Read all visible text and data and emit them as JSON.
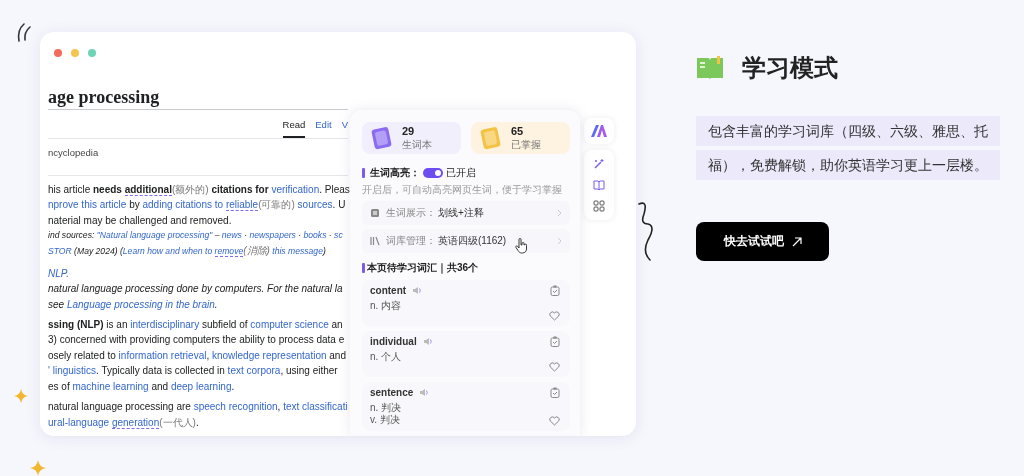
{
  "article": {
    "title": "age processing",
    "tabs": [
      {
        "label": "Read",
        "selected": true
      },
      {
        "label": "Edit",
        "selected": false
      },
      {
        "label": "V",
        "selected": false
      }
    ],
    "subtitle": "ncyclopedia",
    "notice": [
      {
        "italic": false,
        "segments": [
          {
            "text": "his article ",
            "kind": "plain"
          },
          {
            "text": "needs ",
            "kind": "bold"
          },
          {
            "text": "additional",
            "kind": "bold_word"
          },
          {
            "text": "(额外的)",
            "kind": "gloss"
          },
          {
            "text": " citations for ",
            "kind": "bold"
          },
          {
            "text": "verification",
            "kind": "link"
          },
          {
            "text": ". Pleas",
            "kind": "plain"
          }
        ]
      },
      {
        "italic": false,
        "segments": [
          {
            "text": "nprove this article",
            "kind": "link"
          },
          {
            "text": " by ",
            "kind": "plain"
          },
          {
            "text": "adding citations to ",
            "kind": "link"
          },
          {
            "text": "reliable",
            "kind": "link_word"
          },
          {
            "text": "(可靠的)",
            "kind": "gloss"
          },
          {
            "text": " sources",
            "kind": "link"
          },
          {
            "text": ". U",
            "kind": "plain"
          }
        ]
      },
      {
        "italic": false,
        "segments": [
          {
            "text": "naterial may be challenged and removed.",
            "kind": "plain"
          }
        ]
      },
      {
        "italic": true,
        "segments": [
          {
            "text": "ind sources: ",
            "kind": "plain"
          },
          {
            "text": "\"Natural language processing\"",
            "kind": "link"
          },
          {
            "text": " – ",
            "kind": "plain"
          },
          {
            "text": "news",
            "kind": "link"
          },
          {
            "text": " · ",
            "kind": "plain"
          },
          {
            "text": "newspapers",
            "kind": "link"
          },
          {
            "text": " · ",
            "kind": "plain"
          },
          {
            "text": "books",
            "kind": "link"
          },
          {
            "text": " · ",
            "kind": "plain"
          },
          {
            "text": "sc",
            "kind": "link"
          }
        ]
      },
      {
        "italic": true,
        "segments": [
          {
            "text": "STOR",
            "kind": "link"
          },
          {
            "text": " (May 2024) (",
            "kind": "plain"
          },
          {
            "text": "Learn how and when to ",
            "kind": "link"
          },
          {
            "text": "remove",
            "kind": "link_word"
          },
          {
            "text": "(消除)",
            "kind": "gloss"
          },
          {
            "text": " this message",
            "kind": "link"
          },
          {
            "text": ")",
            "kind": "plain"
          }
        ]
      }
    ],
    "hatnote": [
      {
        "italic": true,
        "segments": [
          {
            "text": "NLP.",
            "kind": "link"
          }
        ]
      },
      {
        "italic": true,
        "segments": [
          {
            "text": "natural language processing done by computers. For the natural la",
            "kind": "plain"
          }
        ]
      },
      {
        "italic": true,
        "segments": [
          {
            "text": "see ",
            "kind": "plain"
          },
          {
            "text": "Language processing in the brain",
            "kind": "link"
          },
          {
            "text": ".",
            "kind": "plain"
          }
        ]
      }
    ],
    "paragraphs": [
      [
        {
          "italic": false,
          "segments": [
            {
              "text": "ssing (NLP)",
              "kind": "bold"
            },
            {
              "text": " is an ",
              "kind": "plain"
            },
            {
              "text": "interdisciplinary",
              "kind": "link"
            },
            {
              "text": " subfield of ",
              "kind": "plain"
            },
            {
              "text": "computer science",
              "kind": "link"
            },
            {
              "text": " an",
              "kind": "plain"
            }
          ]
        },
        {
          "italic": false,
          "segments": [
            {
              "text": "3) concerned with providing computers the ability to process data e",
              "kind": "plain"
            }
          ]
        },
        {
          "italic": false,
          "segments": [
            {
              "text": "osely related to ",
              "kind": "plain"
            },
            {
              "text": "information retrieval",
              "kind": "link"
            },
            {
              "text": ", ",
              "kind": "plain"
            },
            {
              "text": "knowledge representation",
              "kind": "link"
            },
            {
              "text": " and",
              "kind": "plain"
            }
          ]
        },
        {
          "italic": false,
          "segments": [
            {
              "text": "' linguistics",
              "kind": "link"
            },
            {
              "text": ". Typically data is collected in ",
              "kind": "plain"
            },
            {
              "text": "text corpora",
              "kind": "link"
            },
            {
              "text": ", using either",
              "kind": "plain"
            }
          ]
        },
        {
          "italic": false,
          "segments": [
            {
              "text": "es of ",
              "kind": "plain"
            },
            {
              "text": "machine learning",
              "kind": "link"
            },
            {
              "text": " and ",
              "kind": "plain"
            },
            {
              "text": "deep learning",
              "kind": "link"
            },
            {
              "text": ".",
              "kind": "plain"
            }
          ]
        }
      ],
      [
        {
          "italic": false,
          "segments": [
            {
              "text": "natural language processing are ",
              "kind": "plain"
            },
            {
              "text": "speech recognition",
              "kind": "link"
            },
            {
              "text": ", ",
              "kind": "plain"
            },
            {
              "text": "text classificati",
              "kind": "link"
            }
          ]
        },
        {
          "italic": false,
          "segments": [
            {
              "text": "ural-language ",
              "kind": "link"
            },
            {
              "text": "generation",
              "kind": "link_word"
            },
            {
              "text": "(一代人)",
              "kind": "gloss"
            },
            {
              "text": ".",
              "kind": "plain"
            }
          ]
        }
      ]
    ]
  },
  "panel": {
    "stats": [
      {
        "count": "29",
        "label": "生词本",
        "color": "#8b6cf0"
      },
      {
        "count": "65",
        "label": "已掌握",
        "color": "#f5c343"
      }
    ],
    "highlight": {
      "label": "生词高亮：",
      "on": true,
      "state_text": "已开启",
      "hint": "开启后，可自动高亮网页生词，便于学习掌握"
    },
    "settings": [
      {
        "kind": "display",
        "label": "生词展示：",
        "value": "划线+注释"
      },
      {
        "kind": "library",
        "label": "词库管理：",
        "value": "英语四级(1162)"
      }
    ],
    "words_title": "本页待学习词汇｜共36个",
    "words": [
      {
        "word": "content",
        "defs": [
          "n. 内容"
        ]
      },
      {
        "word": "individual",
        "defs": [
          "n. 个人"
        ]
      },
      {
        "word": "sentence",
        "defs": [
          "n. 判决",
          "v. 判决"
        ]
      }
    ]
  },
  "feature": {
    "title": "学习模式",
    "description": "包含丰富的学习词库（四级、六级、雅思、托福），免费解锁，助你英语学习更上一层楼。",
    "button": "快去试试吧"
  }
}
